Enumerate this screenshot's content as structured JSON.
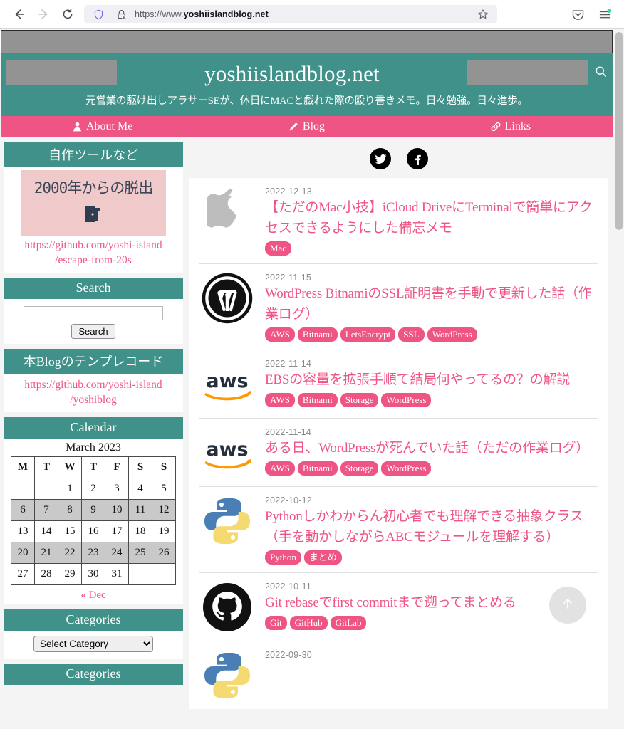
{
  "browser": {
    "back_icon": "back-arrow-icon",
    "forward_icon": "forward-arrow-icon",
    "reload_icon": "reload-icon",
    "shield_icon": "shield-icon",
    "lock_warning_icon": "lock-warning-icon",
    "url_prefix": "https://www.",
    "url_host": "yoshiislandblog.net",
    "url_full": "https://www.yoshiislandblog.net",
    "bookmark_icon": "star-icon",
    "pocket_icon": "pocket-icon",
    "menu_icon": "hamburger-menu-icon"
  },
  "header": {
    "title": "yoshiislandblog.net",
    "description": "元営業の駆け出しアラサーSEが、休日にMACと戯れた際の殴り書きメモ。日々勉強。日々進歩。",
    "search_icon": "search-icon",
    "ad_left_label": "",
    "ad_right_label": "",
    "ad_top_label": ""
  },
  "nav": {
    "items": [
      {
        "label": "About Me",
        "icon": "user-icon"
      },
      {
        "label": "Blog",
        "icon": "pencil-icon"
      },
      {
        "label": "Links",
        "icon": "link-icon"
      }
    ]
  },
  "sidebar": {
    "widgets": [
      {
        "id": "tools",
        "title": "自作ツールなど",
        "banner_title": "2000年からの脱出",
        "banner_icon": "door-exit-icon",
        "link_line1": "https://github.com/yoshi-island",
        "link_line2": "/escape-from-20s"
      },
      {
        "id": "search",
        "title": "Search",
        "input_value": "",
        "input_placeholder": "",
        "button_label": "Search"
      },
      {
        "id": "template",
        "title": "本Blogのテンプレコード",
        "link_line1": "https://github.com/yoshi-island",
        "link_line2": "/yoshiblog"
      },
      {
        "id": "calendar",
        "title": "Calendar",
        "month_label": "March 2023",
        "weekday_headers": [
          "M",
          "T",
          "W",
          "T",
          "F",
          "S",
          "S"
        ],
        "weeks": [
          {
            "shaded": false,
            "days": [
              "",
              "",
              "1",
              "2",
              "3",
              "4",
              "5"
            ]
          },
          {
            "shaded": true,
            "days": [
              "6",
              "7",
              "8",
              "9",
              "10",
              "11",
              "12"
            ]
          },
          {
            "shaded": false,
            "days": [
              "13",
              "14",
              "15",
              "16",
              "17",
              "18",
              "19"
            ]
          },
          {
            "shaded": true,
            "days": [
              "20",
              "21",
              "22",
              "23",
              "24",
              "25",
              "26"
            ]
          },
          {
            "shaded": false,
            "days": [
              "27",
              "28",
              "29",
              "30",
              "31",
              "",
              ""
            ]
          }
        ],
        "prev_link": "« Dec"
      },
      {
        "id": "categories-1",
        "title": "Categories",
        "select_value": "Select Category",
        "select_options": [
          "Select Category"
        ]
      },
      {
        "id": "categories-2",
        "title": "Categories"
      }
    ]
  },
  "main": {
    "social": [
      {
        "name": "twitter-icon",
        "label": "Twitter"
      },
      {
        "name": "facebook-icon",
        "label": "Facebook"
      }
    ],
    "scroll_top_icon": "arrow-up-icon",
    "posts": [
      {
        "date": "2022-12-13",
        "title": "【ただのMac小技】iCloud DriveにTerminalで簡単にアクセスできるようにした備忘メモ",
        "thumb": "apple-logo-icon",
        "tags": [
          "Mac"
        ]
      },
      {
        "date": "2022-11-15",
        "title": "WordPress BitnamiのSSL証明書を手動で更新した話（作業ログ）",
        "thumb": "wordpress-logo-icon",
        "tags": [
          "AWS",
          "Bitnami",
          "LetsEncrypt",
          "SSL",
          "WordPress"
        ]
      },
      {
        "date": "2022-11-14",
        "title": "EBSの容量を拡張手順て結局何やってるの？の解説",
        "thumb": "aws-logo-icon",
        "tags": [
          "AWS",
          "Bitnami",
          "Storage",
          "WordPress"
        ]
      },
      {
        "date": "2022-11-14",
        "title": "ある日、WordPressが死んでいた話（ただの作業ログ）",
        "thumb": "aws-logo-icon",
        "tags": [
          "AWS",
          "Bitnami",
          "Storage",
          "WordPress"
        ]
      },
      {
        "date": "2022-10-12",
        "title": "Pythonしかわからん初心者でも理解できる抽象クラス（手を動かしながらABCモジュールを理解する）",
        "thumb": "python-logo-icon",
        "tags": [
          "Python",
          "まとめ"
        ]
      },
      {
        "date": "2022-10-11",
        "title": "Git rebaseでfirst commitまで遡ってまとめる",
        "thumb": "github-logo-icon",
        "tags": [
          "Git",
          "GitHub",
          "GitLab"
        ]
      },
      {
        "date": "2022-09-30",
        "title": "",
        "thumb": "python-logo-icon",
        "tags": []
      }
    ]
  },
  "colors": {
    "teal": "#3f9189",
    "pink": "#ef5584",
    "banner_pink": "#f0c9cb",
    "ad_gray": "#939393",
    "page_bg": "#f4f4f4"
  }
}
